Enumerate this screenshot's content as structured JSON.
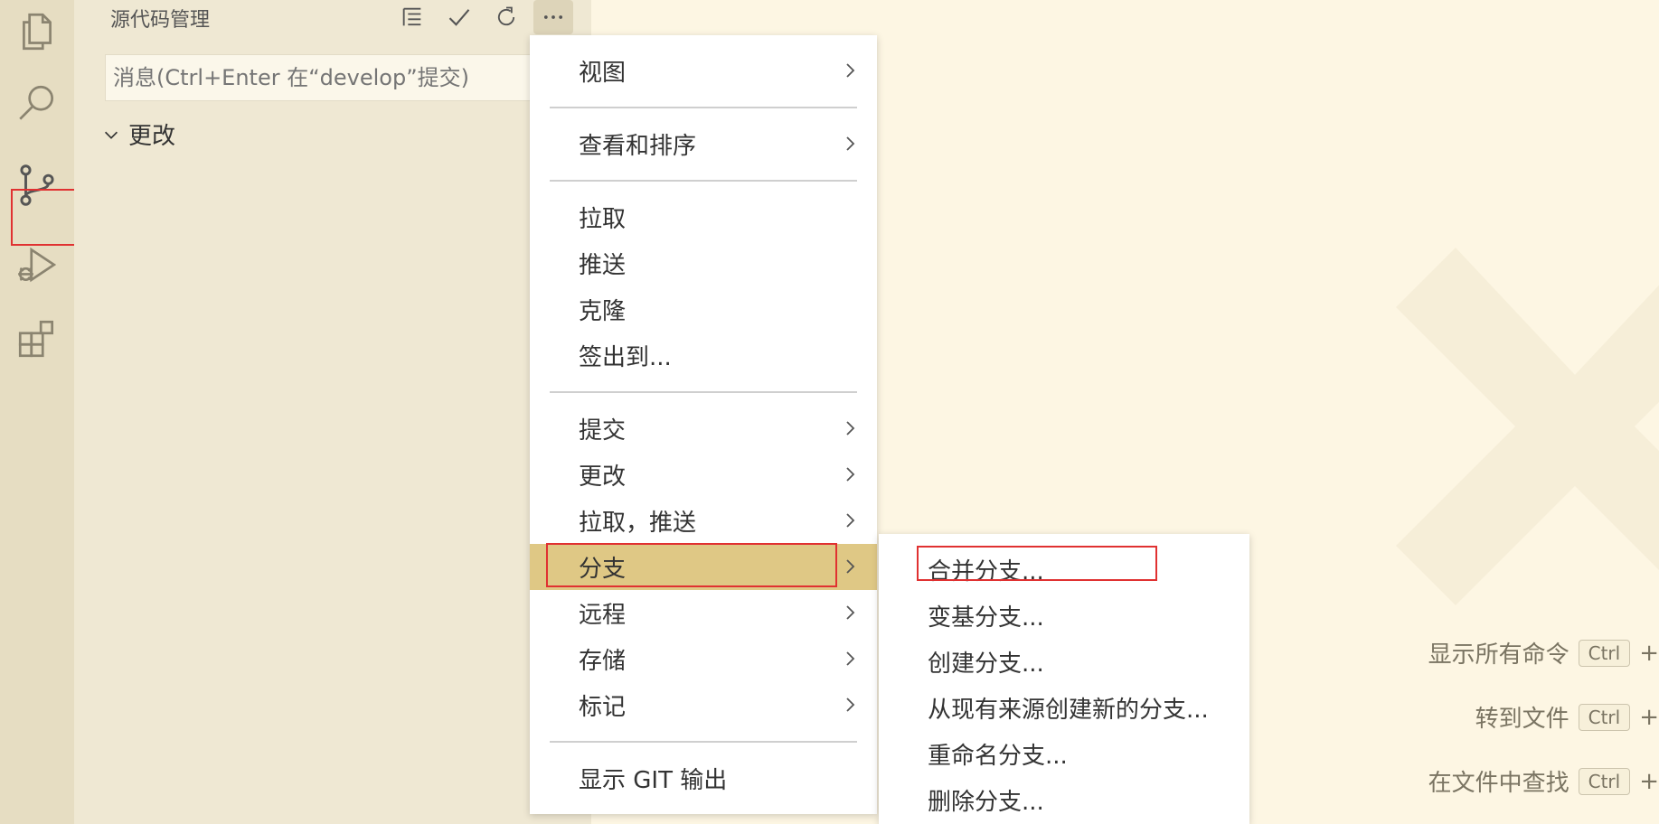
{
  "sidebar": {
    "title": "源代码管理",
    "commit_placeholder": "消息(Ctrl+Enter 在“develop”提交)",
    "changes_label": "更改"
  },
  "main_menu": {
    "items": [
      {
        "label": "视图",
        "has_submenu": true
      },
      {
        "label": "查看和排序",
        "has_submenu": true
      },
      {
        "label": "拉取",
        "has_submenu": false
      },
      {
        "label": "推送",
        "has_submenu": false
      },
      {
        "label": "克隆",
        "has_submenu": false
      },
      {
        "label": "签出到...",
        "has_submenu": false
      },
      {
        "label": "提交",
        "has_submenu": true
      },
      {
        "label": "更改",
        "has_submenu": true
      },
      {
        "label": "拉取，推送",
        "has_submenu": true
      },
      {
        "label": "分支",
        "has_submenu": true,
        "selected": true
      },
      {
        "label": "远程",
        "has_submenu": true
      },
      {
        "label": "存储",
        "has_submenu": true
      },
      {
        "label": "标记",
        "has_submenu": true
      },
      {
        "label": "显示 GIT 输出",
        "has_submenu": false
      }
    ]
  },
  "branch_submenu": {
    "items": [
      {
        "label": "合并分支..."
      },
      {
        "label": "变基分支..."
      },
      {
        "label": "创建分支..."
      },
      {
        "label": "从现有来源创建新的分支..."
      },
      {
        "label": "重命名分支..."
      },
      {
        "label": "删除分支..."
      }
    ]
  },
  "shortcuts": {
    "items": [
      {
        "label": "显示所有命令",
        "key": "Ctrl",
        "plus": "+"
      },
      {
        "label": "转到文件",
        "key": "Ctrl",
        "plus": "+"
      },
      {
        "label": "在文件中查找",
        "key": "Ctrl",
        "plus": "+"
      }
    ]
  },
  "colors": {
    "selection": "#dfc885",
    "highlight_border": "#e03131",
    "editor_bg": "#fdf6e3",
    "sidebar_bg": "#efe8d3",
    "activity_bg": "#e6ddc2"
  }
}
